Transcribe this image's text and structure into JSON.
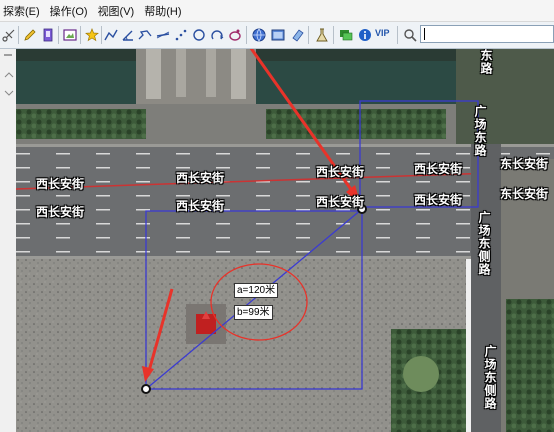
{
  "menu": {
    "items": [
      {
        "label": "探索(E)"
      },
      {
        "label": "操作(O)"
      },
      {
        "label": "视图(V)"
      },
      {
        "label": "帮助(H)"
      }
    ]
  },
  "toolbar": {
    "vip_label": "VIP",
    "search_value": ""
  },
  "map": {
    "road_labels": {
      "xichangan_1": "西长安街",
      "xichangan_2": "西长安街",
      "xichangan_3": "西长安街",
      "xichangan_4": "西长安街",
      "xichangan_5": "西长安街",
      "xichangan_6": "西长安街",
      "xichangan_7": "西长安街",
      "xichangan_8": "西长安街",
      "dongchangan_1": "东长安街",
      "dongchangan_2": "东长安街",
      "guangchang_dong": "广场东路",
      "guangchang_dongce_1": "广场东侧路",
      "guangchang_dongce_2": "广场东侧路",
      "edge_label": "东路"
    },
    "measure_a": "a=120米",
    "measure_b": "b=99米"
  },
  "colors": {
    "measure_line": "#3b3bd1",
    "annotation_arrow": "#e8332a",
    "road_line": "#cc3333"
  }
}
